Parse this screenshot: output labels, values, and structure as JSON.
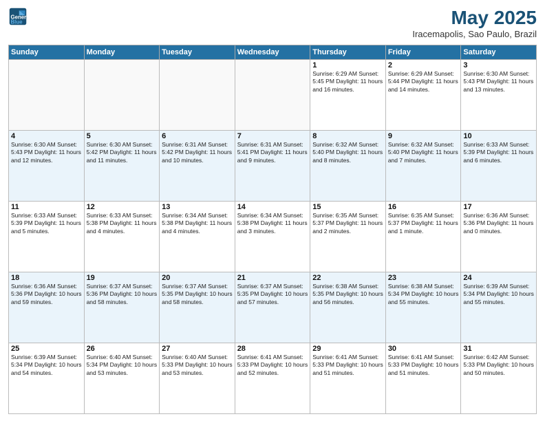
{
  "header": {
    "logo_line1": "General",
    "logo_line2": "Blue",
    "title": "May 2025",
    "subtitle": "Iracemapolis, Sao Paulo, Brazil"
  },
  "weekdays": [
    "Sunday",
    "Monday",
    "Tuesday",
    "Wednesday",
    "Thursday",
    "Friday",
    "Saturday"
  ],
  "weeks": [
    [
      {
        "day": "",
        "info": ""
      },
      {
        "day": "",
        "info": ""
      },
      {
        "day": "",
        "info": ""
      },
      {
        "day": "",
        "info": ""
      },
      {
        "day": "1",
        "info": "Sunrise: 6:29 AM\nSunset: 5:45 PM\nDaylight: 11 hours\nand 16 minutes."
      },
      {
        "day": "2",
        "info": "Sunrise: 6:29 AM\nSunset: 5:44 PM\nDaylight: 11 hours\nand 14 minutes."
      },
      {
        "day": "3",
        "info": "Sunrise: 6:30 AM\nSunset: 5:43 PM\nDaylight: 11 hours\nand 13 minutes."
      }
    ],
    [
      {
        "day": "4",
        "info": "Sunrise: 6:30 AM\nSunset: 5:43 PM\nDaylight: 11 hours\nand 12 minutes."
      },
      {
        "day": "5",
        "info": "Sunrise: 6:30 AM\nSunset: 5:42 PM\nDaylight: 11 hours\nand 11 minutes."
      },
      {
        "day": "6",
        "info": "Sunrise: 6:31 AM\nSunset: 5:42 PM\nDaylight: 11 hours\nand 10 minutes."
      },
      {
        "day": "7",
        "info": "Sunrise: 6:31 AM\nSunset: 5:41 PM\nDaylight: 11 hours\nand 9 minutes."
      },
      {
        "day": "8",
        "info": "Sunrise: 6:32 AM\nSunset: 5:40 PM\nDaylight: 11 hours\nand 8 minutes."
      },
      {
        "day": "9",
        "info": "Sunrise: 6:32 AM\nSunset: 5:40 PM\nDaylight: 11 hours\nand 7 minutes."
      },
      {
        "day": "10",
        "info": "Sunrise: 6:33 AM\nSunset: 5:39 PM\nDaylight: 11 hours\nand 6 minutes."
      }
    ],
    [
      {
        "day": "11",
        "info": "Sunrise: 6:33 AM\nSunset: 5:39 PM\nDaylight: 11 hours\nand 5 minutes."
      },
      {
        "day": "12",
        "info": "Sunrise: 6:33 AM\nSunset: 5:38 PM\nDaylight: 11 hours\nand 4 minutes."
      },
      {
        "day": "13",
        "info": "Sunrise: 6:34 AM\nSunset: 5:38 PM\nDaylight: 11 hours\nand 4 minutes."
      },
      {
        "day": "14",
        "info": "Sunrise: 6:34 AM\nSunset: 5:38 PM\nDaylight: 11 hours\nand 3 minutes."
      },
      {
        "day": "15",
        "info": "Sunrise: 6:35 AM\nSunset: 5:37 PM\nDaylight: 11 hours\nand 2 minutes."
      },
      {
        "day": "16",
        "info": "Sunrise: 6:35 AM\nSunset: 5:37 PM\nDaylight: 11 hours\nand 1 minute."
      },
      {
        "day": "17",
        "info": "Sunrise: 6:36 AM\nSunset: 5:36 PM\nDaylight: 11 hours\nand 0 minutes."
      }
    ],
    [
      {
        "day": "18",
        "info": "Sunrise: 6:36 AM\nSunset: 5:36 PM\nDaylight: 10 hours\nand 59 minutes."
      },
      {
        "day": "19",
        "info": "Sunrise: 6:37 AM\nSunset: 5:36 PM\nDaylight: 10 hours\nand 58 minutes."
      },
      {
        "day": "20",
        "info": "Sunrise: 6:37 AM\nSunset: 5:35 PM\nDaylight: 10 hours\nand 58 minutes."
      },
      {
        "day": "21",
        "info": "Sunrise: 6:37 AM\nSunset: 5:35 PM\nDaylight: 10 hours\nand 57 minutes."
      },
      {
        "day": "22",
        "info": "Sunrise: 6:38 AM\nSunset: 5:35 PM\nDaylight: 10 hours\nand 56 minutes."
      },
      {
        "day": "23",
        "info": "Sunrise: 6:38 AM\nSunset: 5:34 PM\nDaylight: 10 hours\nand 55 minutes."
      },
      {
        "day": "24",
        "info": "Sunrise: 6:39 AM\nSunset: 5:34 PM\nDaylight: 10 hours\nand 55 minutes."
      }
    ],
    [
      {
        "day": "25",
        "info": "Sunrise: 6:39 AM\nSunset: 5:34 PM\nDaylight: 10 hours\nand 54 minutes."
      },
      {
        "day": "26",
        "info": "Sunrise: 6:40 AM\nSunset: 5:34 PM\nDaylight: 10 hours\nand 53 minutes."
      },
      {
        "day": "27",
        "info": "Sunrise: 6:40 AM\nSunset: 5:33 PM\nDaylight: 10 hours\nand 53 minutes."
      },
      {
        "day": "28",
        "info": "Sunrise: 6:41 AM\nSunset: 5:33 PM\nDaylight: 10 hours\nand 52 minutes."
      },
      {
        "day": "29",
        "info": "Sunrise: 6:41 AM\nSunset: 5:33 PM\nDaylight: 10 hours\nand 51 minutes."
      },
      {
        "day": "30",
        "info": "Sunrise: 6:41 AM\nSunset: 5:33 PM\nDaylight: 10 hours\nand 51 minutes."
      },
      {
        "day": "31",
        "info": "Sunrise: 6:42 AM\nSunset: 5:33 PM\nDaylight: 10 hours\nand 50 minutes."
      }
    ]
  ]
}
